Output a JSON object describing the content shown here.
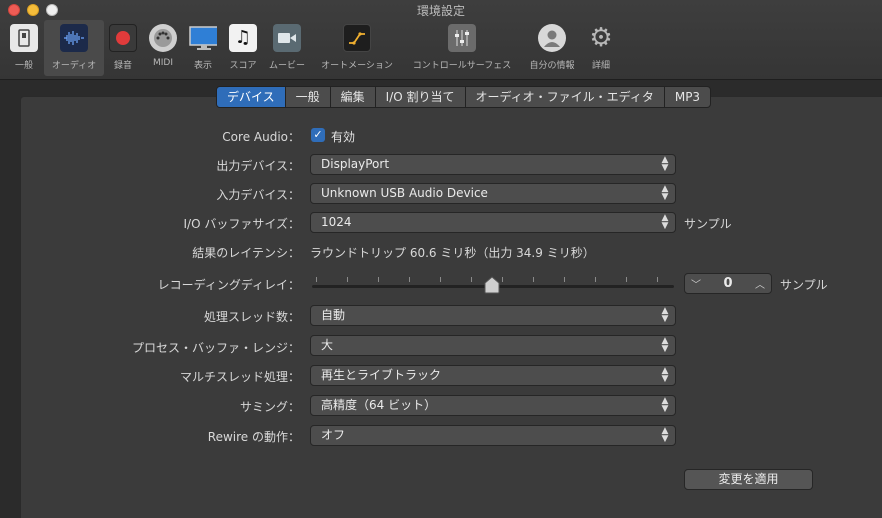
{
  "window": {
    "title": "環境設定"
  },
  "toolbar": [
    {
      "label": "一般",
      "icon": "general-switch-icon"
    },
    {
      "label": "オーディオ",
      "icon": "audio-waveform-icon"
    },
    {
      "label": "録音",
      "icon": "record-icon"
    },
    {
      "label": "MIDI",
      "icon": "midi-connector-icon"
    },
    {
      "label": "表示",
      "icon": "display-monitor-icon"
    },
    {
      "label": "スコア",
      "icon": "score-notes-icon"
    },
    {
      "label": "ムービー",
      "icon": "movie-camera-icon"
    },
    {
      "label": "オートメーション",
      "icon": "automation-icon"
    },
    {
      "label": "コントロールサーフェス",
      "icon": "control-surface-icon"
    },
    {
      "label": "自分の情報",
      "icon": "user-info-icon"
    },
    {
      "label": "詳細",
      "icon": "advanced-gear-icon"
    }
  ],
  "tabs": [
    "デバイス",
    "一般",
    "編集",
    "I/O 割り当て",
    "オーディオ・ファイル・エディタ",
    "MP3"
  ],
  "form": {
    "core_audio_label": "Core Audio：",
    "core_audio_value": "有効",
    "output_device_label": "出力デバイス：",
    "output_device_value": "DisplayPort",
    "input_device_label": "入力デバイス：",
    "input_device_value": "Unknown USB Audio Device",
    "buffer_label": "I/O バッファサイズ：",
    "buffer_value": "1024",
    "buffer_unit": "サンプル",
    "latency_label": "結果のレイテンシ：",
    "latency_value": "ラウンドトリップ 60.6 ミリ秒（出力 34.9 ミリ秒）",
    "rec_delay_label": "レコーディングディレイ：",
    "rec_delay_value": "0",
    "rec_delay_unit": "サンプル",
    "threads_label": "処理スレッド数：",
    "threads_value": "自動",
    "process_buffer_label": "プロセス・バッファ・レンジ：",
    "process_buffer_value": "大",
    "multithread_label": "マルチスレッド処理：",
    "multithread_value": "再生とライブトラック",
    "summing_label": "サミング：",
    "summing_value": "高精度（64 ビット）",
    "rewire_label": "Rewire の動作：",
    "rewire_value": "オフ",
    "apply_button": "変更を適用"
  },
  "colors": {
    "accent": "#2f6db9",
    "background": "#3b3b3b"
  }
}
